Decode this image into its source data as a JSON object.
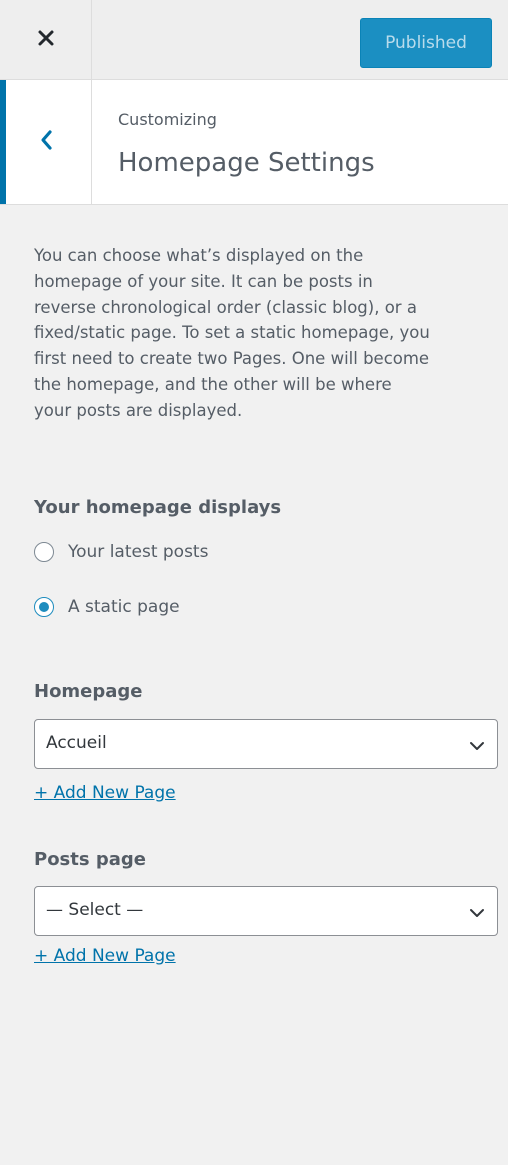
{
  "colors": {
    "accent": "#0073aa",
    "publish_bg": "#1b8fc2",
    "publish_text": "#b9dcec",
    "link": "#0073aa"
  },
  "topbar": {
    "close_icon": "close-icon",
    "publish_label": "Published"
  },
  "section_header": {
    "back_icon": "chevron-left-icon",
    "subtitle": "Customizing",
    "title": "Homepage Settings"
  },
  "description": [
    "You can choose what’s displayed on the",
    "homepage of your site. It can be posts in",
    "reverse chronological order (classic blog), or a",
    "fixed/static page. To set a static homepage, you",
    "first need to create two Pages. One will become",
    "the homepage, and the other will be where",
    "your posts are displayed."
  ],
  "homepage_displays": {
    "title": "Your homepage displays",
    "options": [
      {
        "label": "Your latest posts",
        "checked": false
      },
      {
        "label": "A static page",
        "checked": true
      }
    ]
  },
  "homepage": {
    "title": "Homepage",
    "selected": "Accueil",
    "add_link": "+ Add New Page"
  },
  "posts_page": {
    "title": "Posts page",
    "selected": "— Select —",
    "add_link": "+ Add New Page"
  }
}
